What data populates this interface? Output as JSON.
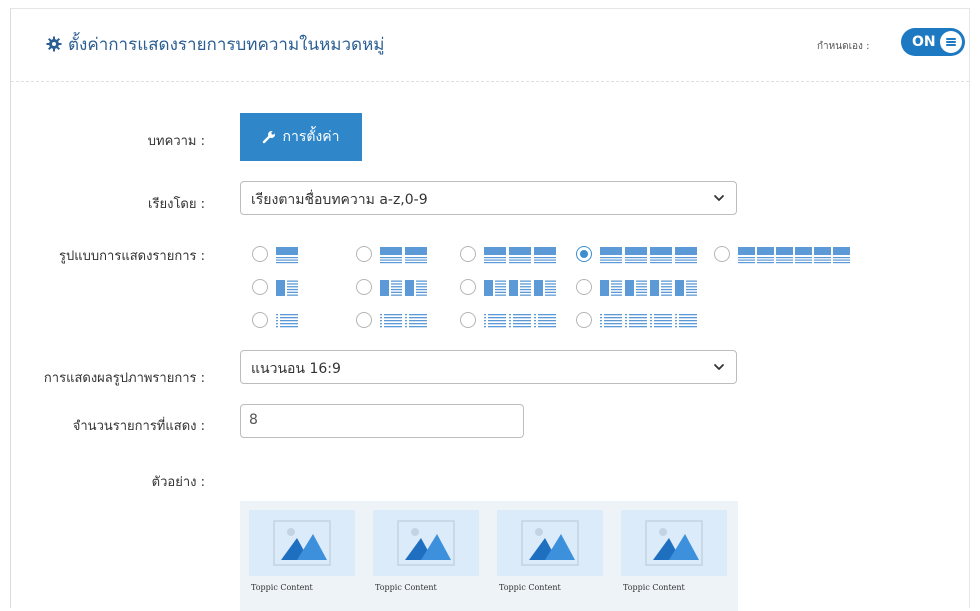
{
  "header": {
    "title": "ตั้งค่าการแสดงรายการบทความในหมวดหมู่",
    "toggle_label": "กำหนดเอง :",
    "toggle_state": "ON"
  },
  "fields": {
    "article_label": "บทความ :",
    "settings_button": "การตั้งค่า",
    "sort_label": "เรียงโดย :",
    "sort_value": "เรียงตามชื่อบทความ a-z,0-9",
    "layout_label": "รูปแบบการแสดงรายการ :",
    "image_label": "การแสดงผลรูปภาพรายการ :",
    "image_value": "แนวนอน 16:9",
    "count_label": "จำนวนรายการที่แสดง :",
    "count_value": "8",
    "preview_label": "ตัวอย่าง :"
  },
  "layout_options": {
    "selected": "grid-4",
    "rows": [
      [
        "grid-1",
        "grid-2",
        "grid-3",
        "grid-4",
        "grid-6"
      ],
      [
        "media-1",
        "media-2",
        "media-3",
        "media-4"
      ],
      [
        "list-1",
        "list-2",
        "list-3",
        "list-4"
      ]
    ]
  },
  "preview": {
    "items": [
      "Toppic Content",
      "Toppic Content",
      "Toppic Content",
      "Toppic Content"
    ]
  },
  "colors": {
    "accent": "#2f86c9",
    "title": "#2b5f93",
    "layout_fill": "#5b9ad6"
  }
}
